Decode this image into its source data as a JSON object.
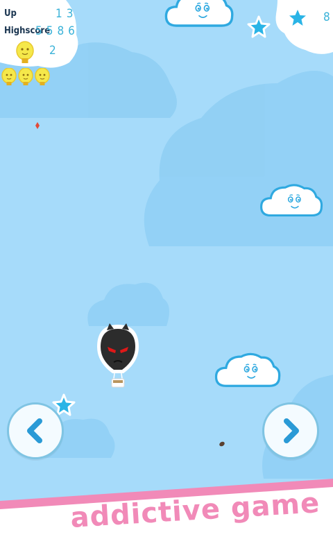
{
  "hud": {
    "up_label": "Up",
    "up_value": "13",
    "highscore_label": "Highscore",
    "highscore_value": "5586",
    "bulb_count": "2",
    "lives": [
      "lightbulb-life-1",
      "lightbulb-life-2",
      "lightbulb-life-3"
    ],
    "star_count": "8"
  },
  "controls": {
    "left_icon": "chevron-left-icon",
    "right_icon": "chevron-right-icon"
  },
  "promo": {
    "text": "addictive game"
  },
  "colors": {
    "sky": "#a6dbfa",
    "cloud_border": "#2fa9e0",
    "star": "#2ab4e6",
    "promo_pink": "#f18ab8",
    "balloon": "#2c2c2c",
    "balloon_eyes": "#e01818"
  }
}
